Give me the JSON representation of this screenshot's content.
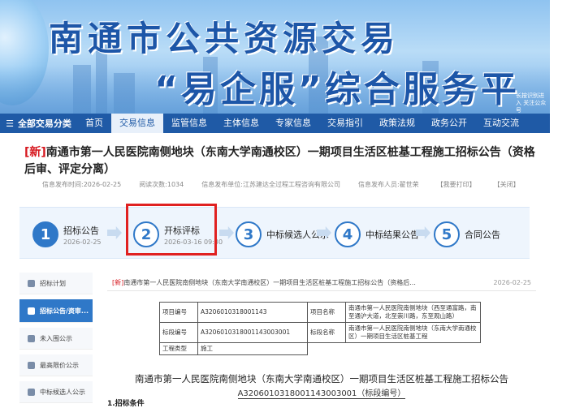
{
  "banner": {
    "title_line1": "南通市公共资源交易",
    "title_line2": "“易企服”综合服务平台",
    "side_text": "长按识别进入 关注公众号 "
  },
  "nav": {
    "all_label": "全部交易分类",
    "items": [
      "首页",
      "交易信息",
      "监管信息",
      "主体信息",
      "专家信息",
      "交易指引",
      "政策法规",
      "政务公开",
      "互动交流"
    ],
    "active_index": 1
  },
  "announcement": {
    "new_tag": "[新]",
    "title": "南通市第一人民医院南侧地块（东南大学南通校区）一期项目生活区桩基工程施工招标公告（资格后审、评定分离）",
    "meta": {
      "publish_time": "信息发布时间:2026-02-25",
      "views": "阅读次数:1034",
      "publisher": "信息发布单位:江苏建达全过程工程咨询有限公司",
      "person": "信息发布人员:翟世荣",
      "favorite": "【我要打印】",
      "close": "【关闭】"
    }
  },
  "steps": [
    {
      "num": "1",
      "label": "招标公告",
      "date": "2026-02-25"
    },
    {
      "num": "2",
      "label": "开标评标",
      "date": "2026-03-16 09:30"
    },
    {
      "num": "3",
      "label": "中标候选人公示",
      "date": ""
    },
    {
      "num": "4",
      "label": "中标结果公告",
      "date": ""
    },
    {
      "num": "5",
      "label": "合同公告",
      "date": ""
    }
  ],
  "sidebar": {
    "items": [
      {
        "label": "招标计划",
        "icon": "bell-icon"
      },
      {
        "label": "招标公告/资审...",
        "icon": "announcement-icon"
      },
      {
        "label": "未入围公示",
        "icon": "document-icon"
      },
      {
        "label": "最高限价公示",
        "icon": "price-icon"
      },
      {
        "label": "中标候选人公示",
        "icon": "list-icon"
      }
    ],
    "active_index": 1
  },
  "document": {
    "new_tag": "[新]",
    "head_title": "南通市第一人民医院南侧地块（东南大学南通校区）一期项目生活区桩基工程施工招标公告（资格后...",
    "date": "2026-02-25",
    "table": {
      "row1": {
        "k1": "项目编号",
        "v1": "A3206010318001143",
        "k2": "项目名称",
        "v2": "南通市第一人民医院南侧地块（西至通富路，南至通沪大道，北至崇川路，东至观山路）"
      },
      "row2": {
        "k1": "标段编号",
        "v1": "A3206010318001143003001",
        "k2": "标段名称",
        "v2": "南通市第一人民医院南侧地块（东南大学南通校区）一期项目生活区桩基工程"
      },
      "row3": {
        "k1": "工程类型",
        "v1": "施工"
      }
    },
    "title": "南通市第一人民医院南侧地块（东南大学南通校区）一期项目生活区桩基工程施工招标公告",
    "subtitle": "A3206010318001143003001（标段编号）",
    "section": "1.招标条件"
  }
}
